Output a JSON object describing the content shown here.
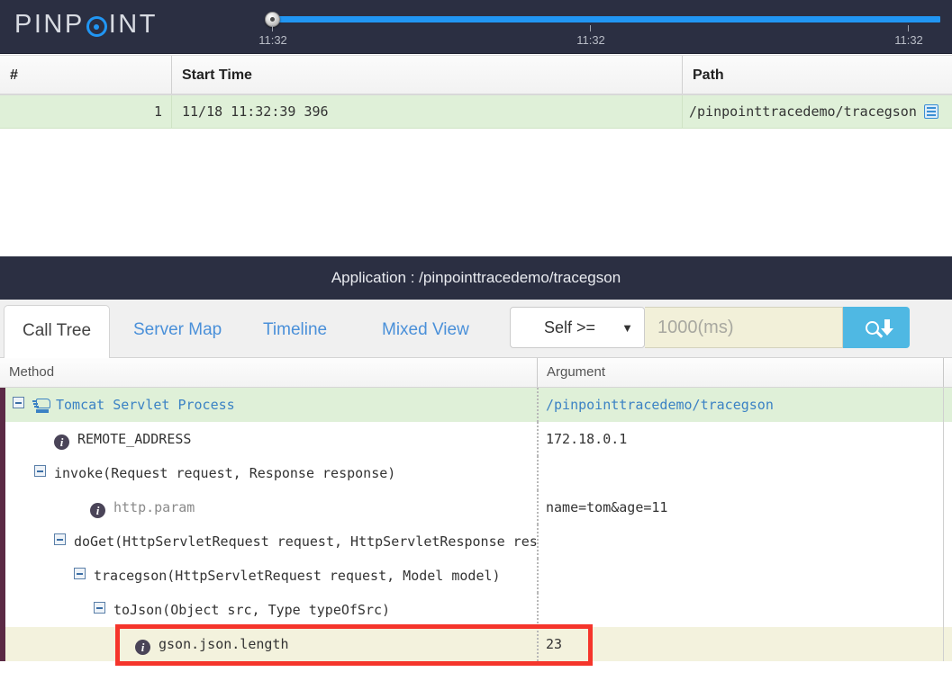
{
  "header": {
    "logo_text_left": "PINP",
    "logo_icon": "pinpoint-o-icon",
    "logo_text_right": "INT"
  },
  "timeslider": {
    "handle_label": "slider-handle",
    "ticks": [
      {
        "label": "11:32",
        "pos_pct": 0
      },
      {
        "label": "11:32",
        "pos_pct": 48.5
      },
      {
        "label": "11:32",
        "pos_pct": 97.5
      }
    ]
  },
  "trace_table": {
    "columns": [
      "#",
      "Start Time",
      "Path"
    ],
    "rows": [
      {
        "index": "1",
        "start_time": "11/18 11:32:39 396",
        "path": "/pinpointtracedemo/tracegson",
        "path_icon": "document-list-icon"
      }
    ]
  },
  "app_bar": {
    "title": "Application : /pinpointtracedemo/tracegson"
  },
  "tabs": [
    {
      "label": "Call Tree",
      "active": true
    },
    {
      "label": "Server Map",
      "active": false
    },
    {
      "label": "Timeline",
      "active": false
    },
    {
      "label": "Mixed View",
      "active": false
    }
  ],
  "filter": {
    "select_value": "Self >=",
    "select_caret": "▼",
    "input_placeholder": "1000(ms)",
    "input_value": "",
    "search_button_icon": "search-download-icon"
  },
  "call_tree": {
    "columns": [
      "Method",
      "Argument"
    ],
    "rows": [
      {
        "method": "Tomcat Servlet Process",
        "argument": "/pinpointtracedemo/tracegson",
        "indent": 14,
        "icon": "tomcat-icon",
        "toggle": true,
        "style": "link",
        "row_style": "green"
      },
      {
        "method": "REMOTE_ADDRESS",
        "argument": "172.18.0.1",
        "indent": 60,
        "icon": "info-icon",
        "toggle": false,
        "style": "normal",
        "row_style": "plain"
      },
      {
        "method": "invoke(Request request, Response response)",
        "argument": "",
        "indent": 38,
        "icon": "none",
        "toggle": true,
        "style": "normal",
        "row_style": "plain"
      },
      {
        "method": "http.param",
        "argument": "name=tom&age=11",
        "indent": 100,
        "icon": "info-icon",
        "toggle": false,
        "style": "dim",
        "row_style": "plain"
      },
      {
        "method": "doGet(HttpServletRequest request, HttpServletResponse res",
        "argument": "",
        "indent": 60,
        "icon": "none",
        "toggle": true,
        "style": "normal",
        "row_style": "plain"
      },
      {
        "method": "tracegson(HttpServletRequest request, Model model)",
        "argument": "",
        "indent": 82,
        "icon": "none",
        "toggle": true,
        "style": "normal",
        "row_style": "plain"
      },
      {
        "method": "toJson(Object src, Type typeOfSrc)",
        "argument": "",
        "indent": 104,
        "icon": "none",
        "toggle": true,
        "style": "normal",
        "row_style": "plain"
      },
      {
        "method": "gson.json.length",
        "argument": "23",
        "indent": 150,
        "icon": "info-icon",
        "toggle": false,
        "style": "normal",
        "row_style": "highlight"
      }
    ]
  },
  "annotation": {
    "name": "red-highlight-box",
    "color": "#f5352b"
  },
  "colors": {
    "nav_bg": "#2b2f42",
    "accent_blue": "#2196f3",
    "row_green": "#dff0d8",
    "row_highlight": "#f3f2dd",
    "link_blue": "#3b82c4",
    "search_btn": "#4fb8e3",
    "annotation_red": "#f5352b"
  }
}
